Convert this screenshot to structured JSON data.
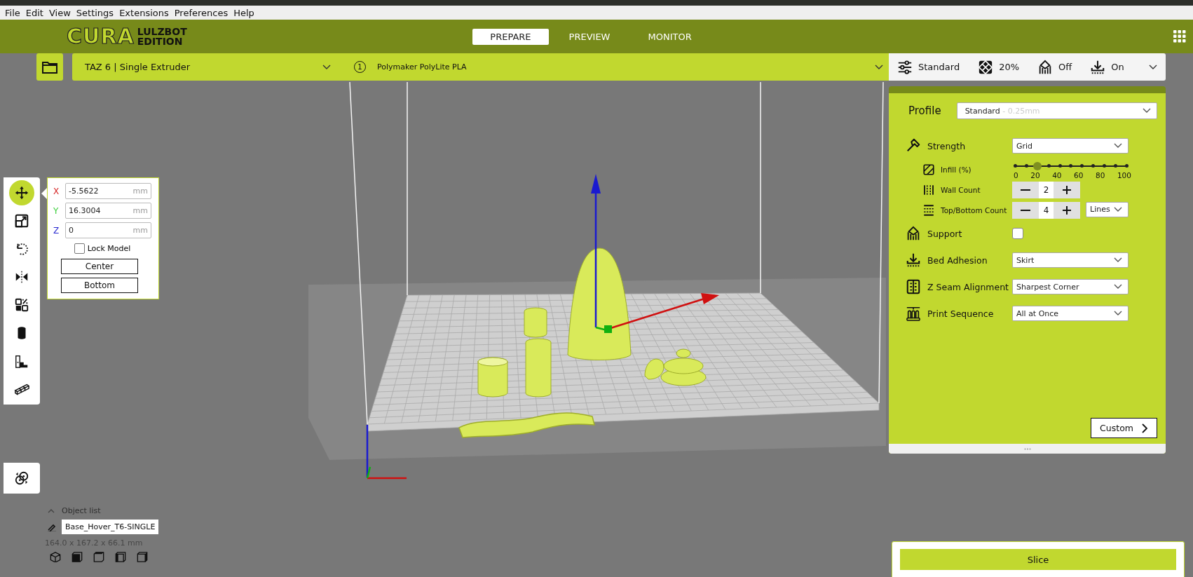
{
  "menu": [
    {
      "label": "File"
    },
    {
      "label": "Edit"
    },
    {
      "label": "View"
    },
    {
      "label": "Settings"
    },
    {
      "label": "Extensions"
    },
    {
      "label": "Preferences"
    },
    {
      "label": "Help"
    }
  ],
  "header": {
    "logo_main": "CURA",
    "logo_sub": [
      "LULZBOT",
      "EDITION"
    ],
    "tabs": [
      {
        "label": "PREPARE",
        "selected": true
      },
      {
        "label": "PREVIEW",
        "selected": false
      },
      {
        "label": "MONITOR",
        "selected": false
      }
    ]
  },
  "printer": {
    "name": "TAZ 6 | Single Extruder"
  },
  "material": {
    "extruder": "1",
    "name": "Polymaker PolyLite PLA"
  },
  "print_summary": [
    {
      "kind": "profile",
      "value": "Standard"
    },
    {
      "kind": "infill",
      "value": "20%"
    },
    {
      "kind": "support",
      "value": "Off"
    },
    {
      "kind": "adhesion",
      "value": "On"
    }
  ],
  "tools": [
    {
      "kind": "move",
      "selected": true
    },
    {
      "kind": "scale",
      "selected": false
    },
    {
      "kind": "rotate",
      "selected": false
    },
    {
      "kind": "mirror",
      "selected": false
    },
    {
      "kind": "per-model",
      "selected": false
    },
    {
      "kind": "support-blocker",
      "selected": false
    },
    {
      "kind": "step",
      "selected": false
    },
    {
      "kind": "multiply",
      "selected": false
    }
  ],
  "extra_tools": [
    {
      "kind": "arrange",
      "selected": false
    }
  ],
  "move_panel": {
    "fields": [
      {
        "axis": "X",
        "value": "-5.5622",
        "unit": "mm",
        "color": "#d62828"
      },
      {
        "axis": "Y",
        "value": "16.3004",
        "unit": "mm",
        "color": "#3ecf3e"
      },
      {
        "axis": "Z",
        "value": "0",
        "unit": "mm",
        "color": "#2a2ad0"
      }
    ],
    "lock_model": {
      "label": "Lock Model",
      "checked": false
    },
    "buttons": [
      "Center",
      "Bottom"
    ]
  },
  "settings": {
    "profile": {
      "label": "Profile",
      "value": "Standard",
      "detail": "- 0.25mm"
    },
    "rows": [
      {
        "kind": "dropdown",
        "label": "Strength",
        "value": "Grid",
        "children": [
          {
            "kind": "slider",
            "label": "Infill (%)",
            "level": 0.2,
            "ticks": [
              "0",
              "20",
              "40",
              "60",
              "80",
              "100"
            ]
          },
          {
            "kind": "stepper",
            "label": "Wall Count",
            "value": "2"
          },
          {
            "kind": "stepper",
            "label": "Top/Bottom Count",
            "value": "4",
            "unit_select": "Lines"
          }
        ]
      },
      {
        "kind": "checkbox",
        "label": "Support",
        "checked": false
      },
      {
        "kind": "dropdown",
        "label": "Bed Adhesion",
        "value": "Skirt"
      },
      {
        "kind": "dropdown",
        "label": "Z Seam Alignment",
        "value": "Sharpest Corner"
      },
      {
        "kind": "dropdown",
        "label": "Print Sequence",
        "value": "All at Once"
      }
    ],
    "custom_button": "Custom"
  },
  "object_list": {
    "title": "Object list",
    "expanded": true,
    "object_name": "Base_Hover_T6-SINGLE",
    "dimensions": "164.0 x 167.2 x 66.1 mm"
  },
  "slice_button": "Slice"
}
